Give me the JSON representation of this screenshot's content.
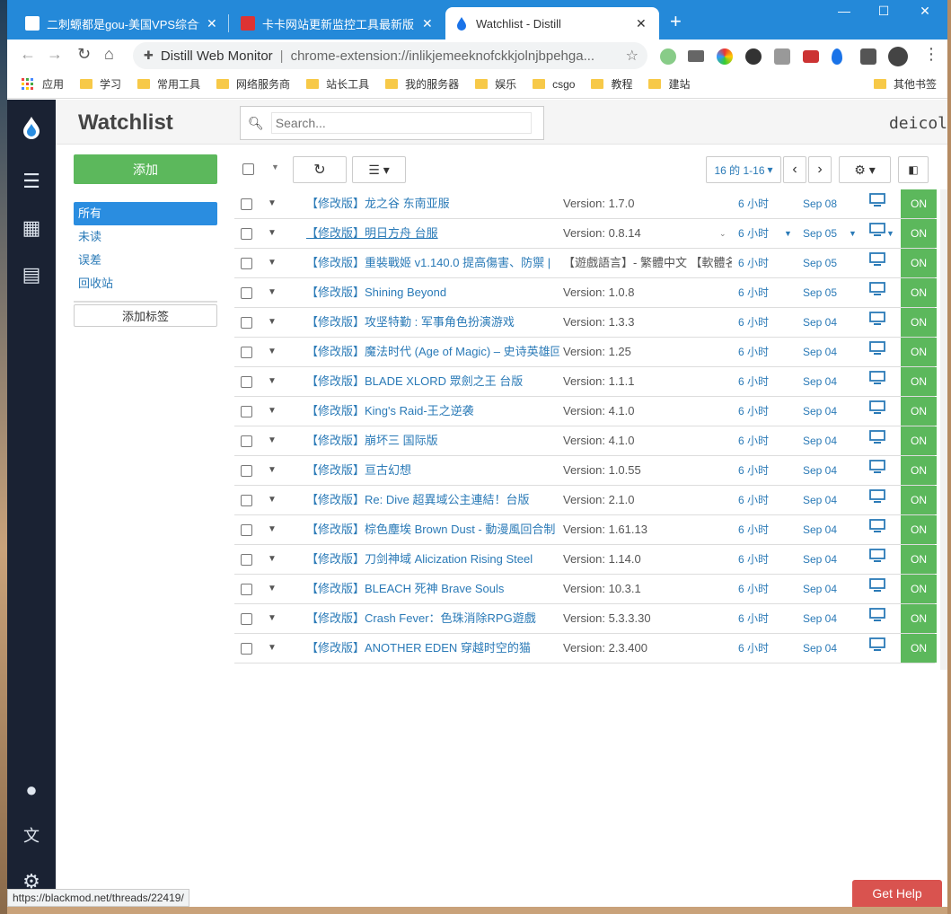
{
  "browser": {
    "tabs": [
      {
        "title": "二刺螈都是gou-美国VPS综合讨",
        "active": false
      },
      {
        "title": "卡卡网站更新监控工具最新版 -",
        "active": false
      },
      {
        "title": "Watchlist - Distill",
        "active": true
      }
    ],
    "address": {
      "site": "Distill Web Monitor",
      "url": "chrome-extension://inlikjemeeknofckkjolnjbpehga..."
    },
    "bookmarks": [
      "应用",
      "学习",
      "常用工具",
      "网络服务商",
      "站长工具",
      "我的服务器",
      "娱乐",
      "csgo",
      "教程",
      "建站"
    ],
    "other_bookmarks": "其他书签"
  },
  "app": {
    "title": "Watchlist",
    "search_placeholder": "Search...",
    "username": "deicol",
    "add_button": "添加",
    "filters": [
      "所有",
      "未读",
      "误差",
      "回收站"
    ],
    "add_label": "添加标签",
    "pagination": "16 的 1-16"
  },
  "rows": [
    {
      "name": "【修改版】龙之谷 东南亚服",
      "version": "Version: 1.7.0",
      "interval": "6 小时",
      "date": "Sep 08",
      "status": "ON"
    },
    {
      "name": "【修改版】明日方舟 台服",
      "version": "Version: 0.8.14",
      "interval": "6 小时",
      "date": "Sep 05",
      "status": "ON"
    },
    {
      "name": "【修改版】重裝戰姬 v1.140.0 提高傷害、防禦 |",
      "version": "【遊戲語言】- 繁體中文 【軟體名",
      "interval": "6 小时",
      "date": "Sep 05",
      "status": "ON"
    },
    {
      "name": "【修改版】Shining Beyond",
      "version": "Version: 1.0.8",
      "interval": "6 小时",
      "date": "Sep 05",
      "status": "ON"
    },
    {
      "name": "【修改版】攻坚特勤 : 军事角色扮演游戏",
      "version": "Version: 1.3.3",
      "interval": "6 小时",
      "date": "Sep 04",
      "status": "ON"
    },
    {
      "name": "【修改版】魔法时代 (Age of Magic) – 史诗英雄回",
      "version": "Version: 1.25",
      "interval": "6 小时",
      "date": "Sep 04",
      "status": "ON"
    },
    {
      "name": "【修改版】BLADE XLORD 眾劍之王 台版",
      "version": "Version: 1.1.1",
      "interval": "6 小时",
      "date": "Sep 04",
      "status": "ON"
    },
    {
      "name": "【修改版】King's Raid-王之逆袭",
      "version": "Version: 4.1.0",
      "interval": "6 小时",
      "date": "Sep 04",
      "status": "ON"
    },
    {
      "name": "【修改版】崩坏三 国际版",
      "version": "Version: 4.1.0",
      "interval": "6 小时",
      "date": "Sep 04",
      "status": "ON"
    },
    {
      "name": "【修改版】亘古幻想",
      "version": "Version: 1.0.55",
      "interval": "6 小时",
      "date": "Sep 04",
      "status": "ON"
    },
    {
      "name": "【修改版】Re: Dive 超異域公主連結！台版",
      "version": "Version: 2.1.0",
      "interval": "6 小时",
      "date": "Sep 04",
      "status": "ON"
    },
    {
      "name": "【修改版】棕色塵埃 Brown Dust - 動漫風回合制",
      "version": "Version: 1.61.13",
      "interval": "6 小时",
      "date": "Sep 04",
      "status": "ON"
    },
    {
      "name": "【修改版】刀剑神域 Alicization Rising Steel",
      "version": "Version: 1.14.0",
      "interval": "6 小时",
      "date": "Sep 04",
      "status": "ON"
    },
    {
      "name": "【修改版】BLEACH 死神 Brave Souls",
      "version": "Version: 10.3.1",
      "interval": "6 小时",
      "date": "Sep 04",
      "status": "ON"
    },
    {
      "name": "【修改版】Crash Fever：色珠消除RPG遊戲",
      "version": "Version: 5.3.3.30",
      "interval": "6 小时",
      "date": "Sep 04",
      "status": "ON"
    },
    {
      "name": "【修改版】ANOTHER EDEN 穿越时空的猫",
      "version": "Version: 2.3.400",
      "interval": "6 小时",
      "date": "Sep 04",
      "status": "ON"
    }
  ],
  "status_url": "https://blackmod.net/threads/22419/",
  "help_button": "Get Help",
  "colors": {
    "accent": "#2a8de0",
    "on": "#5cb85c",
    "help": "#d9534f",
    "sidebar": "#1a2233"
  }
}
